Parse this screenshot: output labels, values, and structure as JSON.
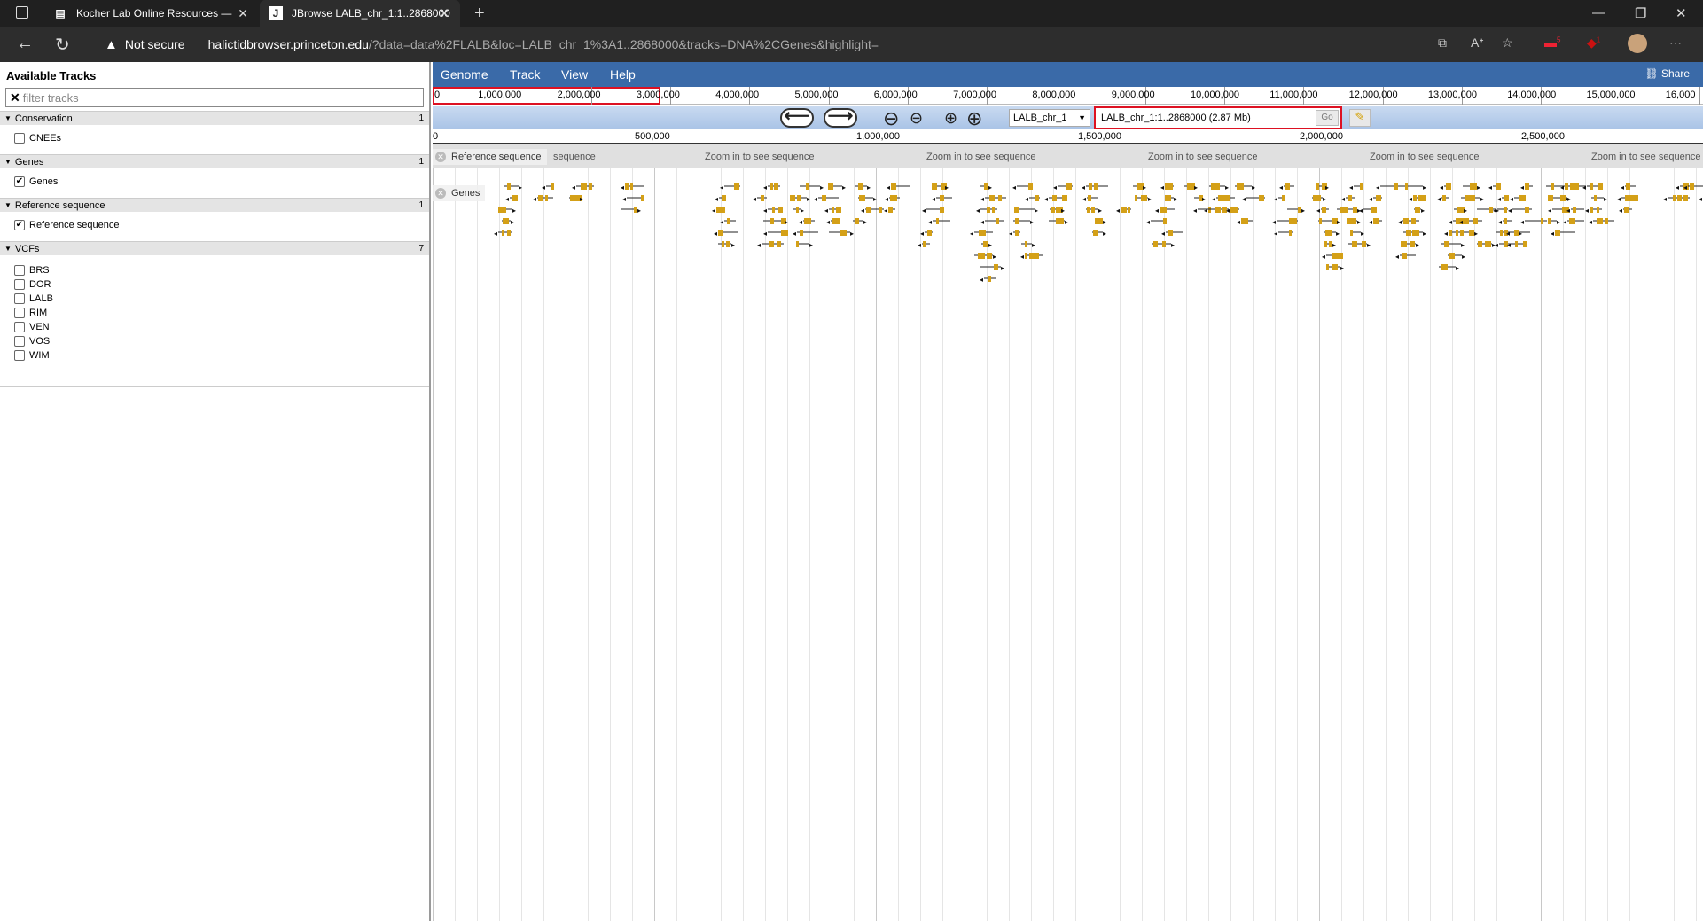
{
  "browser": {
    "tabs": [
      {
        "title": "Kocher Lab Online Resources —",
        "icon": "document-icon"
      },
      {
        "title": "JBrowse LALB_chr_1:1..2868000",
        "icon": "J"
      }
    ],
    "security": "Not secure",
    "url_host": "halictidbrowser.princeton.edu",
    "url_path": "/?data=data%2FLALB&loc=LALB_chr_1%3A1..2868000&tracks=DNA%2CGenes&highlight=",
    "badges": {
      "ext1": "5",
      "ext2": "1"
    }
  },
  "sidebar": {
    "title": "Available Tracks",
    "filter_placeholder": "filter tracks",
    "categories": [
      {
        "name": "Conservation",
        "count": "1",
        "tracks": [
          {
            "label": "CNEEs",
            "checked": false
          }
        ]
      },
      {
        "name": "Genes",
        "count": "1",
        "tracks": [
          {
            "label": "Genes",
            "checked": true
          }
        ]
      },
      {
        "name": "Reference sequence",
        "count": "1",
        "tracks": [
          {
            "label": "Reference sequence",
            "checked": true
          }
        ]
      },
      {
        "name": "VCFs",
        "count": "7",
        "tracks": [
          {
            "label": "BRS",
            "checked": false
          },
          {
            "label": "DOR",
            "checked": false
          },
          {
            "label": "LALB",
            "checked": false
          },
          {
            "label": "RIM",
            "checked": false
          },
          {
            "label": "VEN",
            "checked": false
          },
          {
            "label": "VOS",
            "checked": false
          },
          {
            "label": "WIM",
            "checked": false
          }
        ]
      }
    ]
  },
  "menu": {
    "items": [
      "Genome",
      "Track",
      "View",
      "Help"
    ],
    "share": "Share"
  },
  "overview": {
    "labels": [
      "0",
      "1,000,000",
      "2,000,000",
      "3,000,000",
      "4,000,000",
      "5,000,000",
      "6,000,000",
      "7,000,000",
      "8,000,000",
      "9,000,000",
      "10,000,000",
      "11,000,000",
      "12,000,000",
      "13,000,000",
      "14,000,000",
      "15,000,000",
      "16,000"
    ]
  },
  "navigation": {
    "ref_seq": "LALB_chr_1",
    "location": "LALB_chr_1:1..2868000 (2.87 Mb)",
    "go_label": "Go"
  },
  "scale": {
    "labels": [
      "0",
      "500,000",
      "1,000,000",
      "1,500,000",
      "2,000,000",
      "2,500,000"
    ]
  },
  "tracks": {
    "reference_label": "Reference sequence",
    "genes_label": "Genes",
    "seq_message": "Zoom in to see sequence",
    "seq_partial": "sequence"
  },
  "colors": {
    "menubar": "#3a6aa8",
    "gene_feature": "#d4a017",
    "highlight": "#dd1122"
  }
}
